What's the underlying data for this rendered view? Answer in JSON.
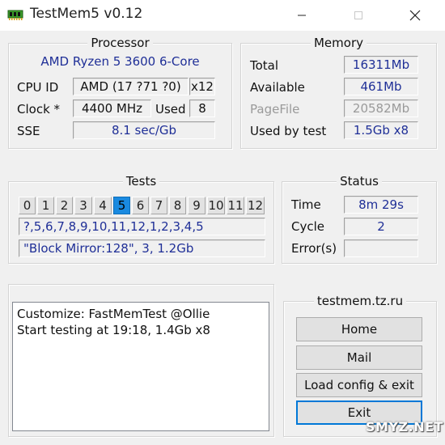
{
  "window": {
    "title": "TestMem5 v0.12",
    "icon": "memory-chip-icon",
    "controls": [
      "minimize-icon",
      "maximize-icon",
      "close-icon"
    ]
  },
  "processor": {
    "legend": "Processor",
    "name": "AMD Ryzen 5 3600 6-Core",
    "cpu_id_label": "CPU ID",
    "cpu_id_value": "AMD  (17 ?71 ?0)",
    "threads": "x12",
    "clock_label": "Clock *",
    "clock_value": "4400 MHz",
    "used_label": "Used",
    "used_value": "8",
    "sse_label": "SSE",
    "sse_value": "8.1 sec/Gb"
  },
  "memory": {
    "legend": "Memory",
    "total_label": "Total",
    "total_value": "16311Mb",
    "available_label": "Available",
    "available_value": "461Mb",
    "pagefile_label": "PageFile",
    "pagefile_value": "20582Mb",
    "used_label": "Used by test",
    "used_value": "1.5Gb x8"
  },
  "tests": {
    "legend": "Tests",
    "numbers": [
      "0",
      "1",
      "2",
      "3",
      "4",
      "5",
      "6",
      "7",
      "8",
      "9",
      "10",
      "11",
      "12"
    ],
    "active_index": 5,
    "sequence": "?,5,6,7,8,9,10,11,12,1,2,3,4,5",
    "current": "\"Block Mirror:128\", 3, 1.2Gb"
  },
  "status": {
    "legend": "Status",
    "time_label": "Time",
    "time_value": "8m 29s",
    "cycle_label": "Cycle",
    "cycle_value": "2",
    "errors_label": "Error(s)",
    "errors_value": ""
  },
  "log": {
    "lines": [
      "Customize: FastMemTest @Ollie",
      "Start testing at 19:18, 1.4Gb x8"
    ]
  },
  "links": {
    "legend": "testmem.tz.ru",
    "home": "Home",
    "mail": "Mail",
    "load_config": "Load config & exit",
    "exit": "Exit"
  },
  "watermark": "SMYZ.NET",
  "colors": {
    "accent": "#1a8ae0",
    "value_text": "#1f2f97",
    "window_bg": "#f0f0f0",
    "focus_border": "#0078d7"
  }
}
